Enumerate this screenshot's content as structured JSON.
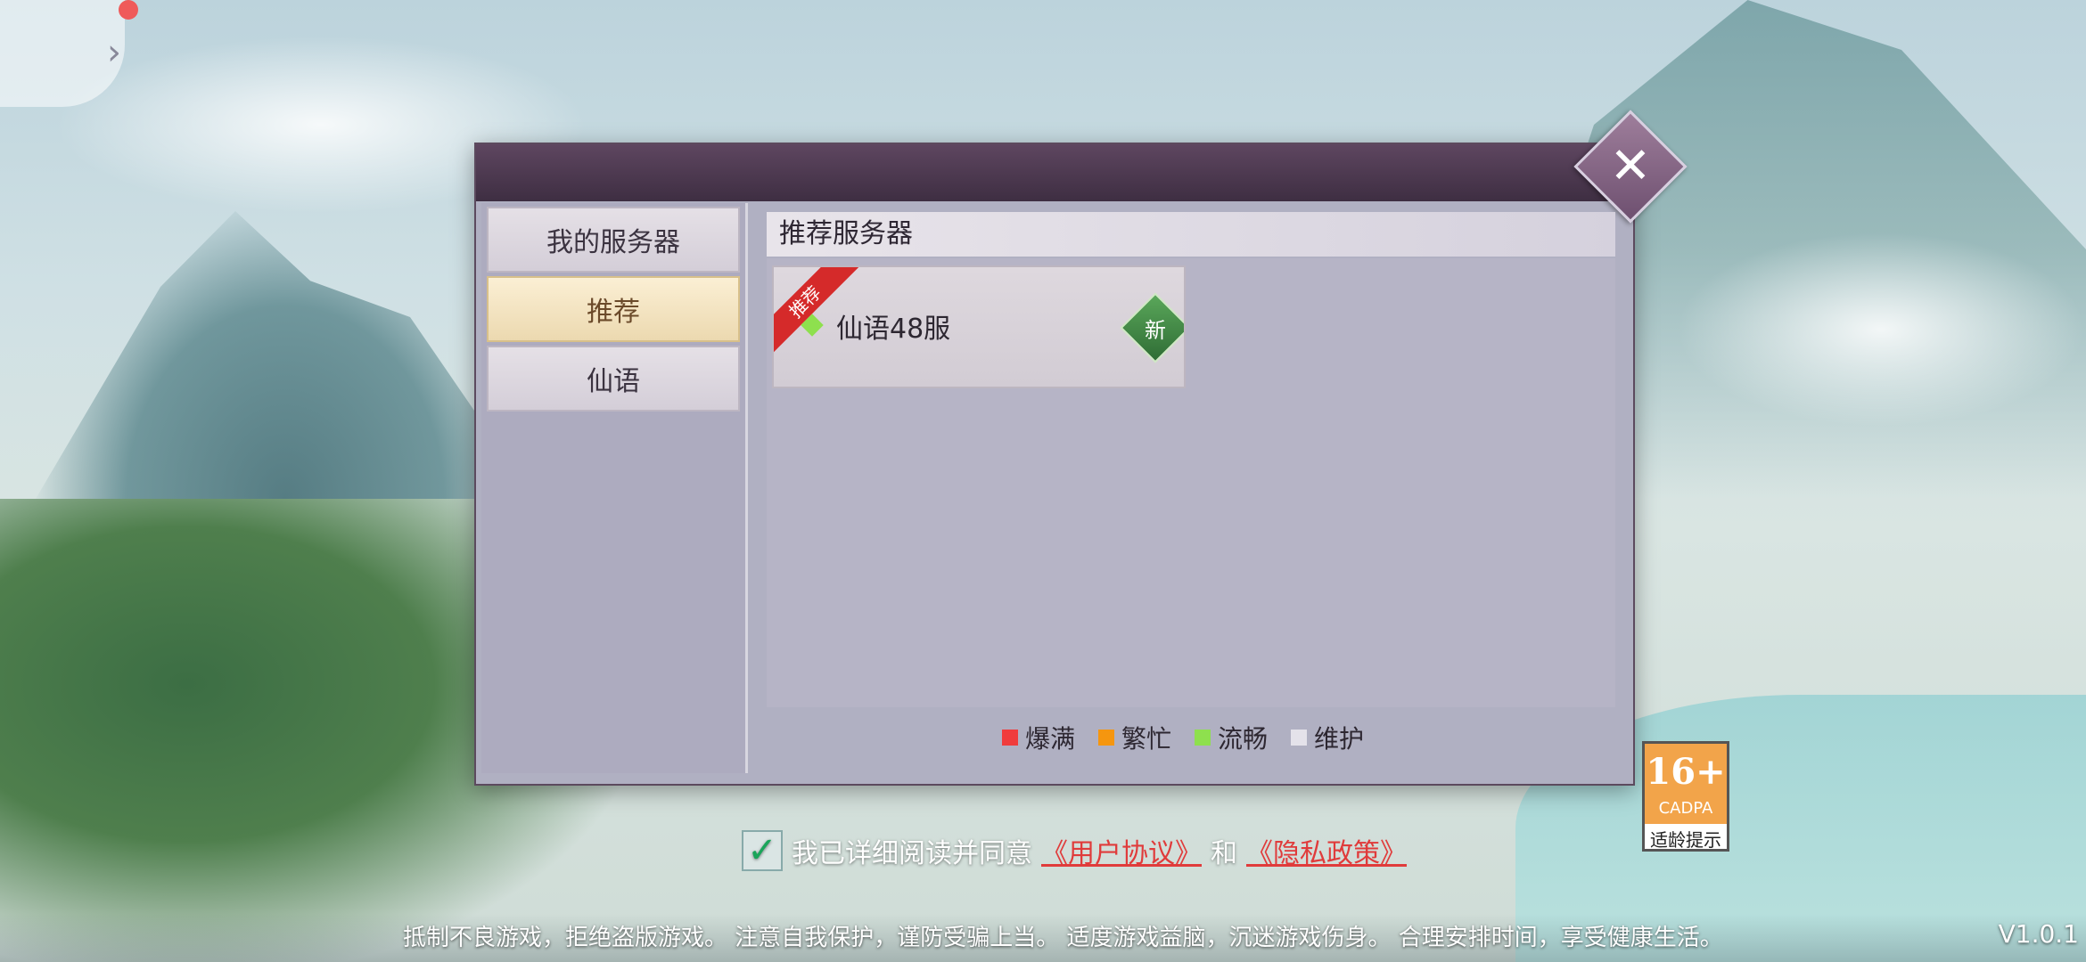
{
  "sidebar": {
    "tabs": [
      {
        "label": "我的服务器"
      },
      {
        "label": "推荐"
      },
      {
        "label": "仙语"
      }
    ]
  },
  "main": {
    "section_title": "推荐服务器",
    "servers": [
      {
        "ribbon": "推荐",
        "name": "仙语48服",
        "badge": "新",
        "status_color": "#8ee04e"
      }
    ]
  },
  "legend": [
    {
      "label": "爆满",
      "color": "#f03c3c"
    },
    {
      "label": "繁忙",
      "color": "#f5960f"
    },
    {
      "label": "流畅",
      "color": "#8ee04e"
    },
    {
      "label": "维护",
      "color": "#e4e2ea"
    }
  ],
  "agreement": {
    "prefix": "我已详细阅读并同意",
    "user_agreement": "《用户协议》",
    "and": "和",
    "privacy_policy": "《隐私政策》",
    "checked": true
  },
  "age_rating": {
    "age": "16+",
    "org": "CADPA",
    "label": "适龄提示"
  },
  "notice": "抵制不良游戏，拒绝盗版游戏。 注意自我保护，谨防受骗上当。 适度游戏益脑，沉迷游戏伤身。 合理安排时间，享受健康生活。",
  "version": "V1.0.1"
}
